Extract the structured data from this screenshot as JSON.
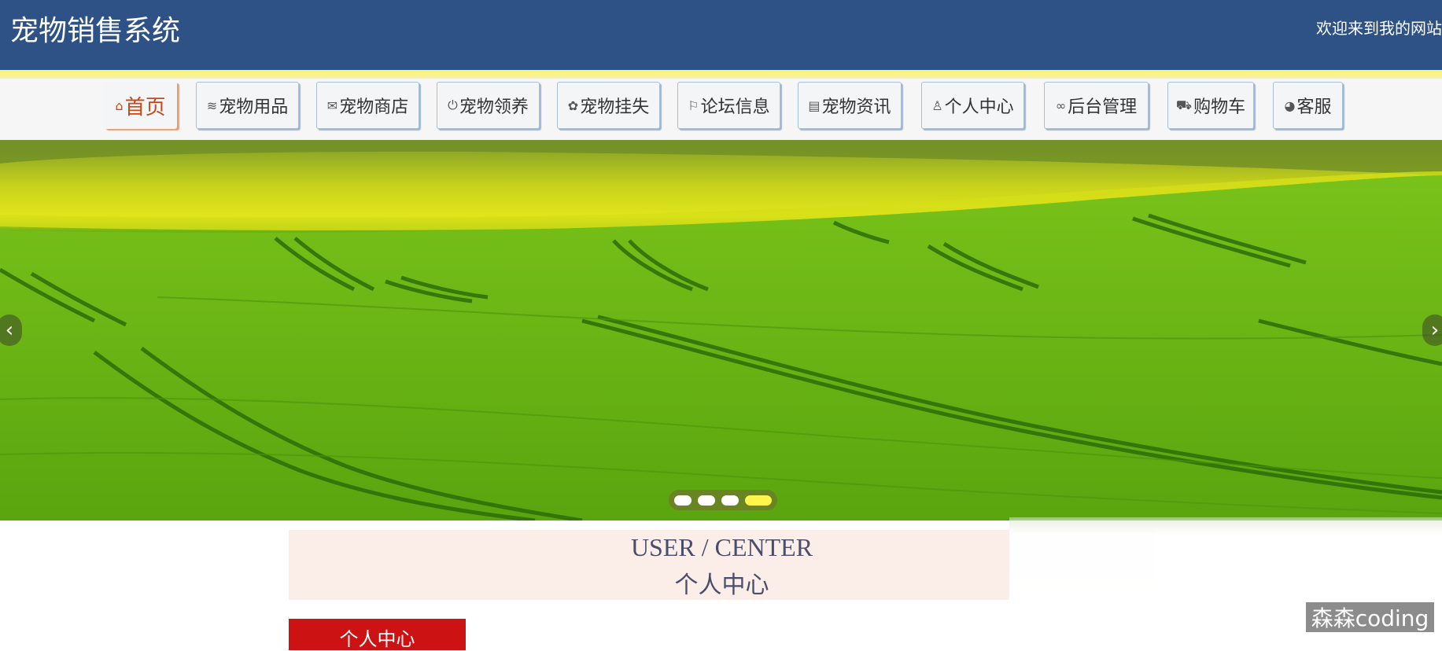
{
  "header": {
    "site_title": "宠物销售系统",
    "welcome_text": "欢迎来到我的网站"
  },
  "nav": {
    "items": [
      {
        "label": "首页",
        "icon": "home-icon",
        "glyph": "⌂",
        "active": true
      },
      {
        "label": "宠物用品",
        "icon": "layers-icon",
        "glyph": "≋",
        "active": false
      },
      {
        "label": "宠物商店",
        "icon": "mail-icon",
        "glyph": "✉",
        "active": false
      },
      {
        "label": "宠物领养",
        "icon": "power-icon",
        "glyph": "⏻",
        "active": false
      },
      {
        "label": "宠物挂失",
        "icon": "palette-icon",
        "glyph": "✿",
        "active": false
      },
      {
        "label": "论坛信息",
        "icon": "flag-icon",
        "glyph": "⚐",
        "active": false
      },
      {
        "label": "宠物资讯",
        "icon": "clipboard-icon",
        "glyph": "▤",
        "active": false
      },
      {
        "label": "个人中心",
        "icon": "user-icon",
        "glyph": "♙",
        "active": false
      },
      {
        "label": "后台管理",
        "icon": "link-icon",
        "glyph": "∞",
        "active": false
      },
      {
        "label": "购物车",
        "icon": "cart-icon",
        "glyph": "⛟",
        "active": false
      },
      {
        "label": "客服",
        "icon": "chat-icon",
        "glyph": "◕",
        "active": false
      }
    ]
  },
  "carousel": {
    "prev_glyph": "‹",
    "next_glyph": "›",
    "slide_count": 4,
    "active_index": 3
  },
  "center_banner": {
    "title_en": "USER / CENTER",
    "title_zh": "个人中心"
  },
  "side_menu": {
    "active_label": "个人中心"
  },
  "watermark": {
    "text": "森森coding"
  },
  "colors": {
    "header_bg": "#2f5286",
    "accent_yellow": "#fff56a",
    "active_nav": "#c44a1a",
    "button_red": "#cc1212",
    "banner_bg": "#fbede8"
  }
}
